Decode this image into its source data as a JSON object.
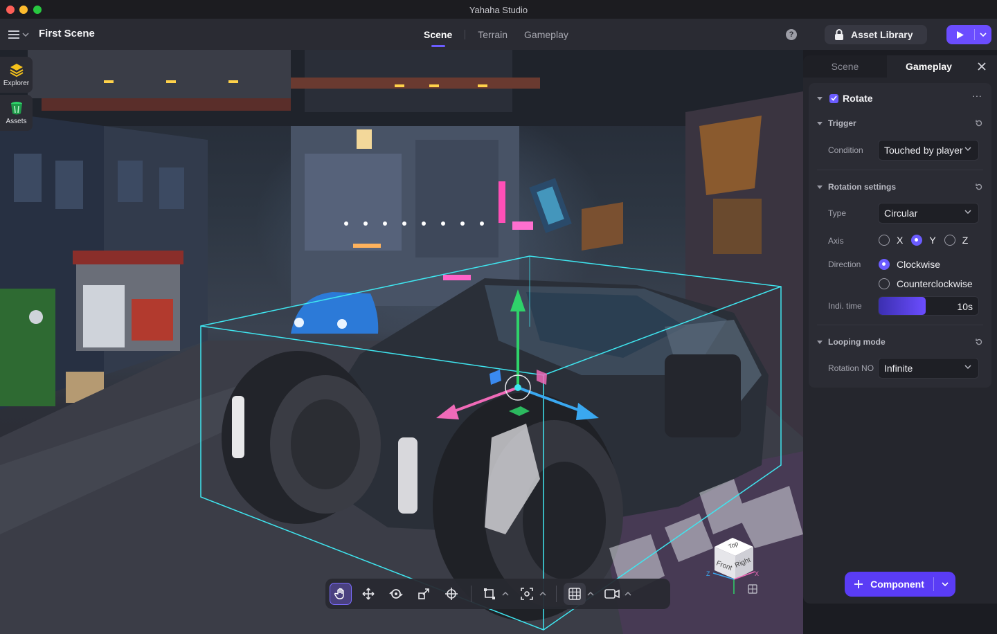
{
  "window": {
    "title": "Yahaha Studio"
  },
  "header": {
    "scene_title": "First Scene",
    "tabs": [
      {
        "label": "Scene",
        "active": true
      },
      {
        "label": "Terrain",
        "active": false
      },
      {
        "label": "Gameplay",
        "active": false
      }
    ],
    "help_label": "?",
    "asset_library_label": "Asset Library"
  },
  "side_tools": [
    {
      "label": "Explorer",
      "icon": "layers-icon"
    },
    {
      "label": "Assets",
      "icon": "bucket-icon"
    }
  ],
  "viewport": {
    "gizmo_cube": {
      "top": "Top",
      "front": "Front",
      "right": "Right"
    },
    "axis_labels": {
      "z": "Z",
      "x": "X"
    }
  },
  "toolbar": {
    "tools": [
      "hand-tool",
      "move-tool",
      "rotate-tool",
      "scale-tool",
      "transform-tool",
      "snap-tool",
      "focus-tool",
      "grid-tool",
      "camera-tool"
    ],
    "active_tool": "hand-tool"
  },
  "panel": {
    "tabs": [
      {
        "label": "Scene",
        "active": false
      },
      {
        "label": "Gameplay",
        "active": true
      }
    ],
    "component": {
      "name": "Rotate",
      "enabled": true,
      "more_label": "···"
    },
    "trigger": {
      "title": "Trigger",
      "condition_label": "Condition",
      "condition_value": "Touched by player"
    },
    "rotation_settings": {
      "title": "Rotation settings",
      "type_label": "Type",
      "type_value": "Circular",
      "axis_label": "Axis",
      "axis_options": [
        "X",
        "Y",
        "Z"
      ],
      "axis_selected": "Y",
      "direction_label": "Direction",
      "direction_options": [
        "Clockwise",
        "Counterclockwise"
      ],
      "direction_selected": "Clockwise",
      "time_label": "Indi. time",
      "time_value": "10s",
      "time_fraction": 0.47
    },
    "looping_mode": {
      "title": "Looping mode",
      "rotation_no_label": "Rotation NO",
      "rotation_no_value": "Infinite"
    },
    "add_component_label": "Component"
  },
  "colors": {
    "accent": "#6b4dff",
    "bounds_cyan": "#3fe6f0",
    "gizmo_green": "#2fd36a",
    "gizmo_blue": "#3aa8f0",
    "gizmo_pink": "#f06ab8"
  }
}
